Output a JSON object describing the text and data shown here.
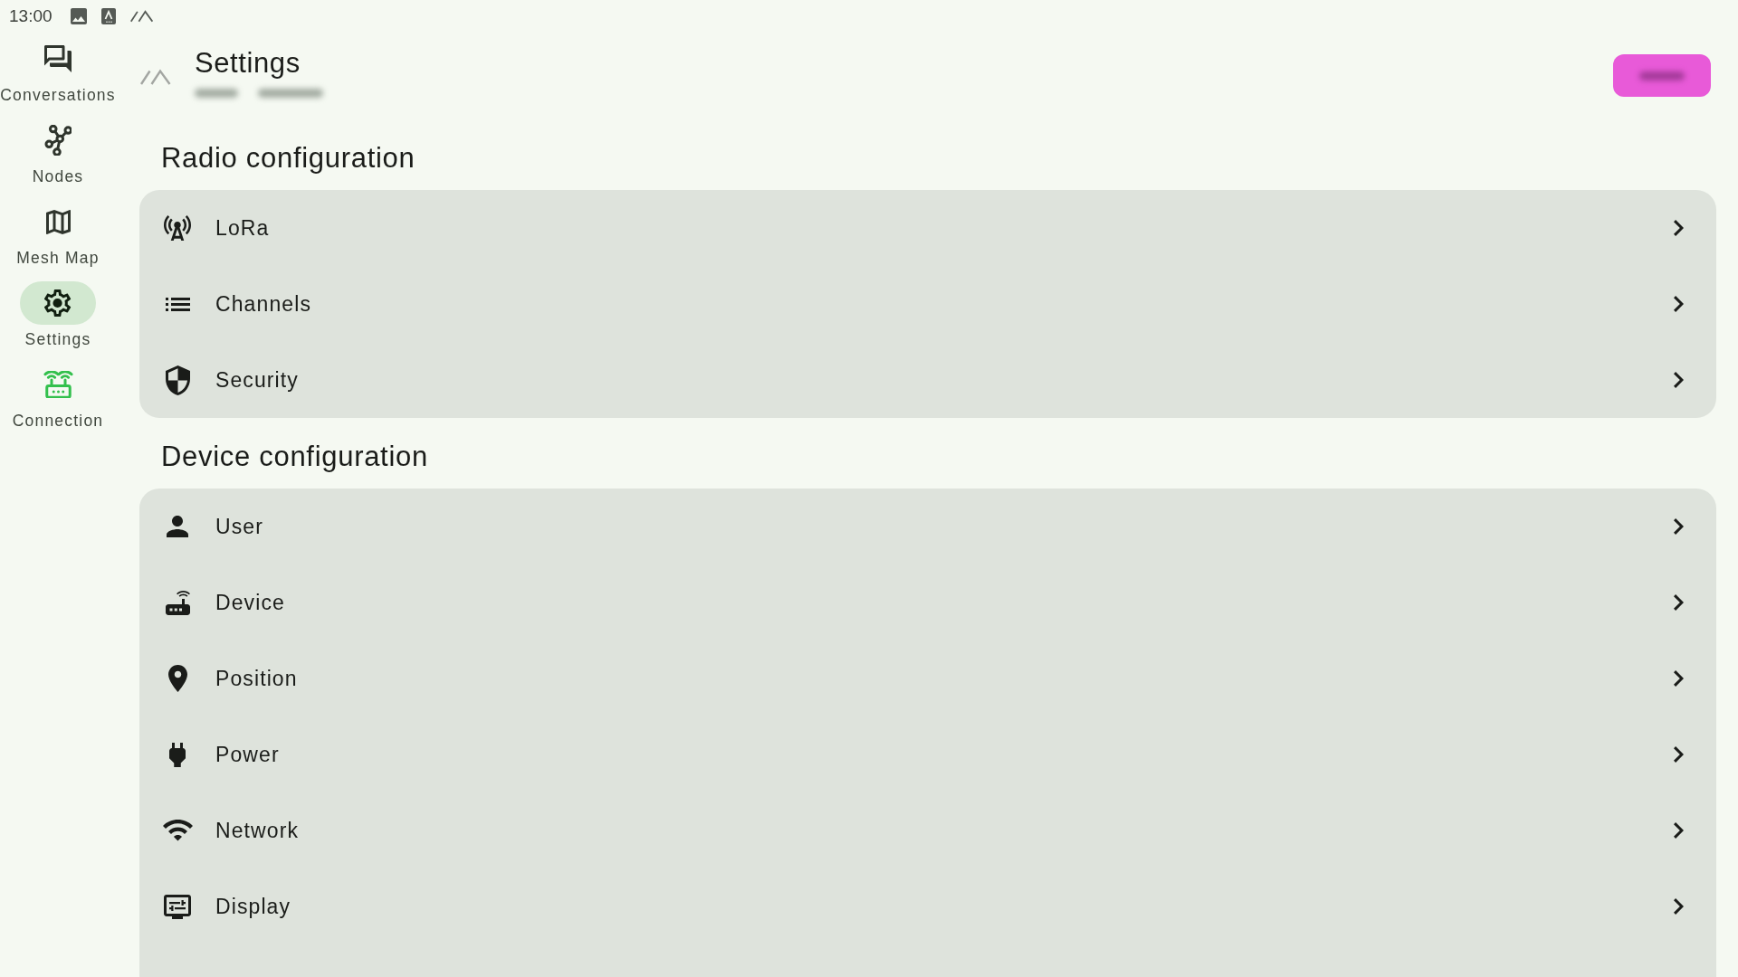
{
  "status_bar": {
    "time": "13:00"
  },
  "nav": {
    "items": [
      {
        "label": "Conversations",
        "selected": false
      },
      {
        "label": "Nodes",
        "selected": false
      },
      {
        "label": "Mesh Map",
        "selected": false
      },
      {
        "label": "Settings",
        "selected": true
      },
      {
        "label": "Connection",
        "selected": false,
        "color": "#33c04d"
      }
    ]
  },
  "header": {
    "title": "Settings"
  },
  "sections": [
    {
      "title": "Radio configuration",
      "items": [
        {
          "label": "LoRa"
        },
        {
          "label": "Channels"
        },
        {
          "label": "Security"
        }
      ]
    },
    {
      "title": "Device configuration",
      "items": [
        {
          "label": "User"
        },
        {
          "label": "Device"
        },
        {
          "label": "Position"
        },
        {
          "label": "Power"
        },
        {
          "label": "Network"
        },
        {
          "label": "Display"
        }
      ]
    }
  ]
}
